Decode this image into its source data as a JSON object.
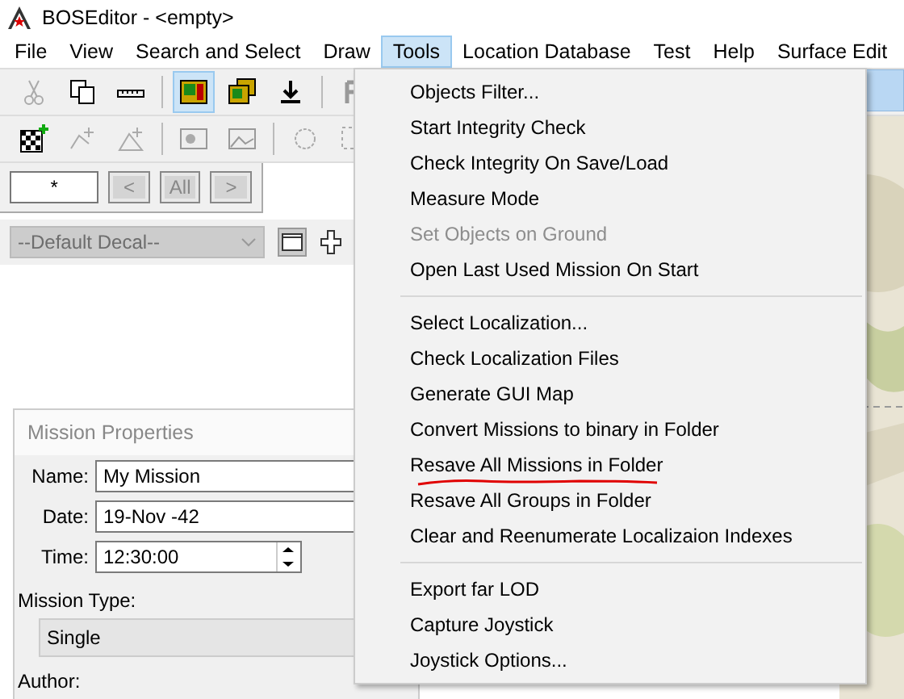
{
  "window": {
    "title": "BOSEditor - <empty>"
  },
  "menu_bar": [
    {
      "label": "File",
      "selected": false
    },
    {
      "label": "View",
      "selected": false
    },
    {
      "label": "Search and Select",
      "selected": false
    },
    {
      "label": "Draw",
      "selected": false
    },
    {
      "label": "Tools",
      "selected": true
    },
    {
      "label": "Location Database",
      "selected": false
    },
    {
      "label": "Test",
      "selected": false
    },
    {
      "label": "Help",
      "selected": false
    },
    {
      "label": "Surface Edit",
      "selected": false
    }
  ],
  "filter_buttons": [
    {
      "label": "*",
      "disabled": false
    },
    {
      "label": "<",
      "disabled": true
    },
    {
      "label": "All",
      "disabled": true
    },
    {
      "label": ">",
      "disabled": true
    }
  ],
  "decal_select": {
    "value": "--Default Decal--",
    "disabled": true
  },
  "tools_menu": [
    {
      "kind": "item",
      "label": "Objects Filter...",
      "disabled": false,
      "marked": false
    },
    {
      "kind": "item",
      "label": "Start Integrity Check",
      "disabled": false,
      "marked": false
    },
    {
      "kind": "item",
      "label": "Check Integrity On Save/Load",
      "disabled": false,
      "marked": false
    },
    {
      "kind": "item",
      "label": "Measure Mode",
      "disabled": false,
      "marked": false
    },
    {
      "kind": "item",
      "label": "Set Objects on Ground",
      "disabled": true,
      "marked": false
    },
    {
      "kind": "item",
      "label": "Open Last Used Mission On Start",
      "disabled": false,
      "marked": false
    },
    {
      "kind": "separator"
    },
    {
      "kind": "item",
      "label": "Select Localization...",
      "disabled": false,
      "marked": false
    },
    {
      "kind": "item",
      "label": "Check Localization Files",
      "disabled": false,
      "marked": false
    },
    {
      "kind": "item",
      "label": "Generate GUI Map",
      "disabled": false,
      "marked": false
    },
    {
      "kind": "item",
      "label": "Convert Missions to binary in Folder",
      "disabled": false,
      "marked": false
    },
    {
      "kind": "item",
      "label": "Resave All Missions in Folder",
      "disabled": false,
      "marked": true
    },
    {
      "kind": "item",
      "label": "Resave All Groups in Folder",
      "disabled": false,
      "marked": false
    },
    {
      "kind": "item",
      "label": "Clear and Reenumerate Localizaion Indexes",
      "disabled": false,
      "marked": false
    },
    {
      "kind": "separator"
    },
    {
      "kind": "item",
      "label": "Export far LOD",
      "disabled": false,
      "marked": false
    },
    {
      "kind": "item",
      "label": "Capture Joystick",
      "disabled": false,
      "marked": false
    },
    {
      "kind": "item",
      "label": "Joystick Options...",
      "disabled": false,
      "marked": false
    }
  ],
  "mission_properties": {
    "title": "Mission Properties",
    "fields": [
      {
        "kind": "text",
        "label": "Name:",
        "value": "My Mission"
      },
      {
        "kind": "text",
        "label": "Date:",
        "value": "19-Nov -42"
      },
      {
        "kind": "spin",
        "label": "Time:",
        "value": "12:30:00"
      }
    ],
    "mission_type": {
      "label": "Mission Type:",
      "value": "Single"
    },
    "author": {
      "label": "Author:"
    }
  }
}
